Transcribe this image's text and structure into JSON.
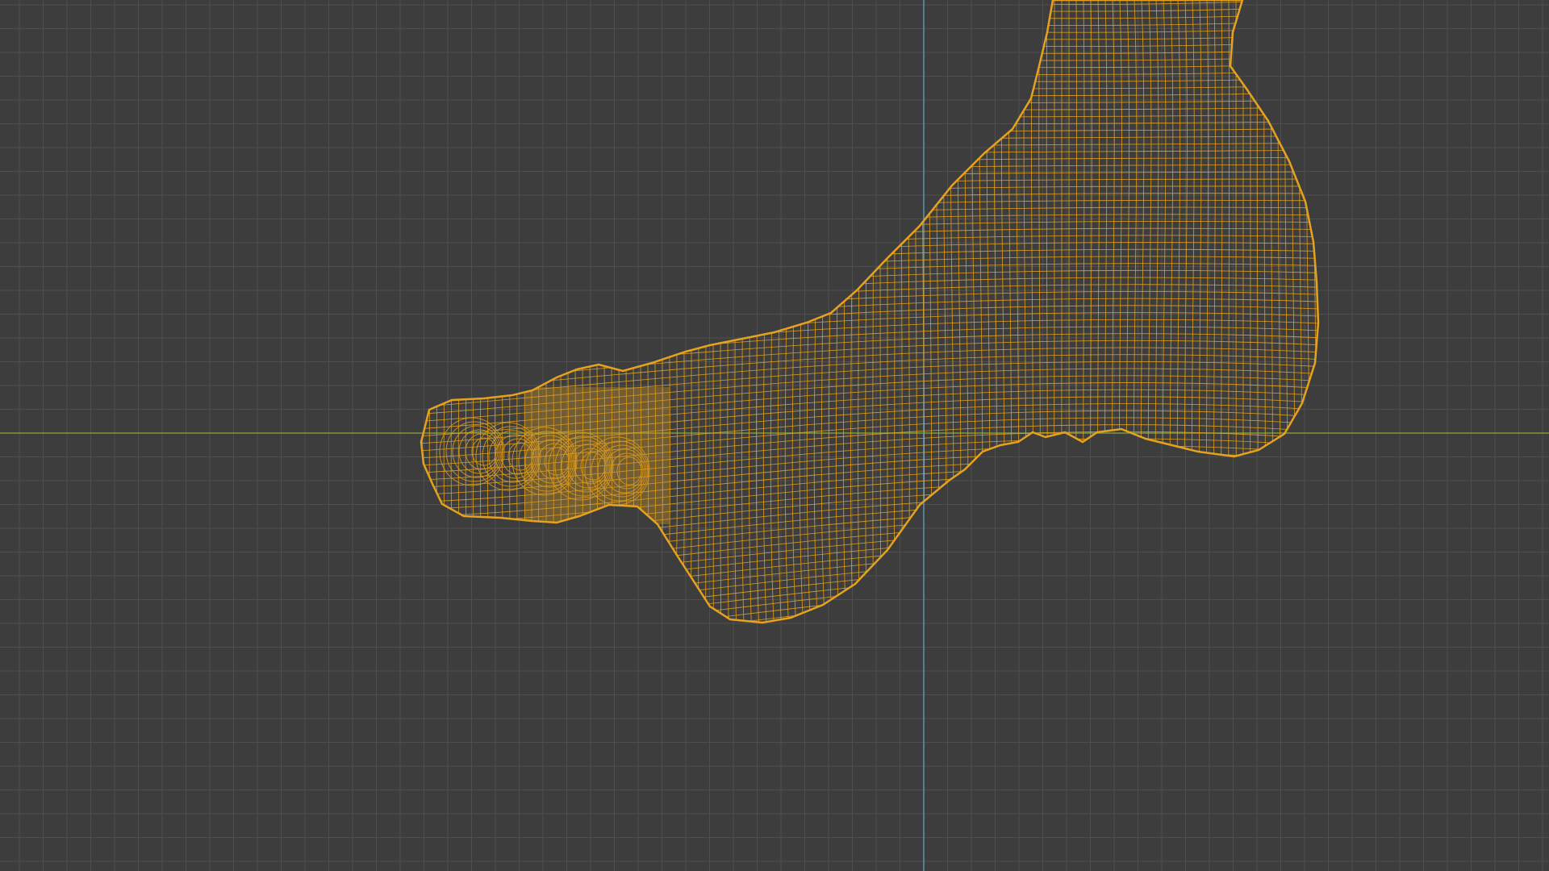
{
  "viewport": {
    "view_mode": "wireframe",
    "view_angle": "side",
    "grid_visible": true,
    "x_axis_visible": true,
    "z_axis_visible": true,
    "selected_object": "foot-mesh"
  },
  "colors": {
    "background": "#3d3d3d",
    "grid_line": "#4f4f4f",
    "x_axis": "#7c9a3c",
    "z_axis": "#5b93b1",
    "wire": "#e5a21f",
    "wire_dense": "#d6971c"
  },
  "icons": {
    "mesh": "wireframe-foot-mesh"
  }
}
